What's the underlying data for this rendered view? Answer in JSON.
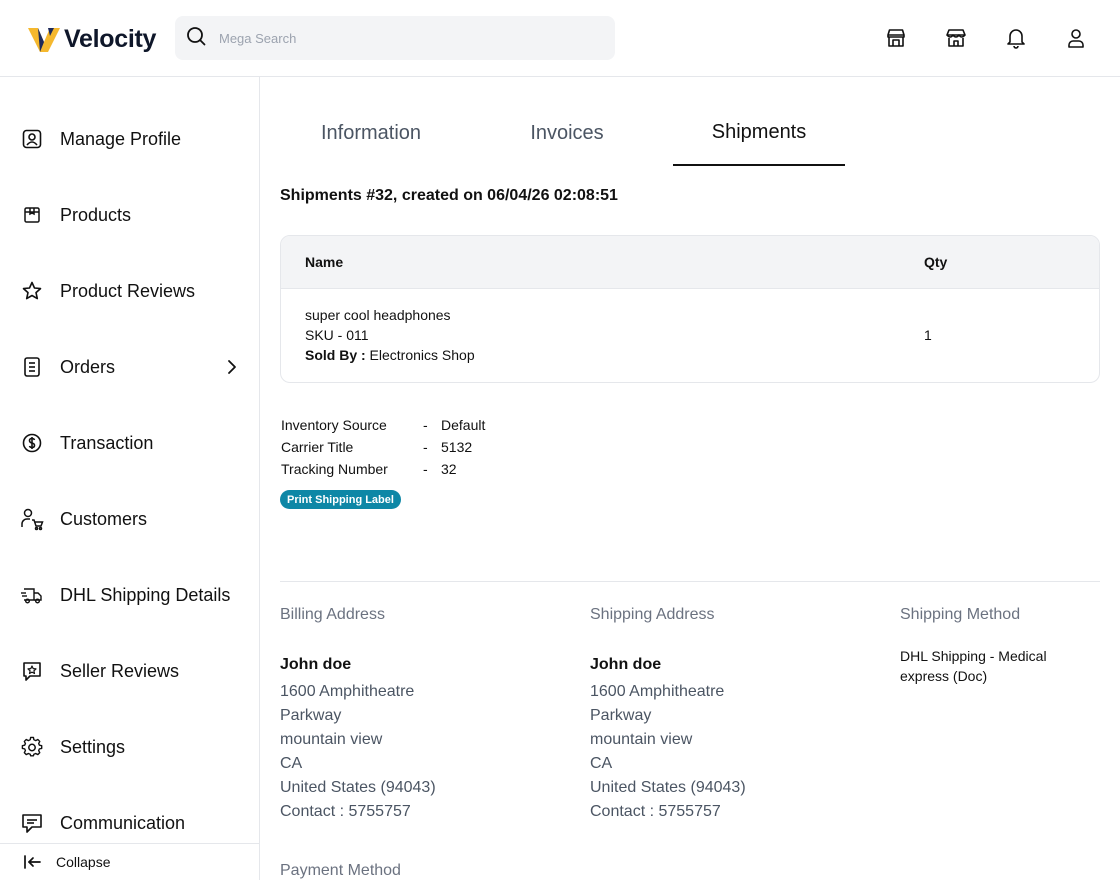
{
  "brand": {
    "name": "Velocity",
    "accent": "#f5b82e"
  },
  "search": {
    "placeholder": "Mega Search",
    "icon": "search-icon"
  },
  "header_icons": [
    "store-icon",
    "shop-icon",
    "bell-icon",
    "user-icon"
  ],
  "sidebar": {
    "items": [
      {
        "label": "Manage Profile",
        "icon": "profile-icon"
      },
      {
        "label": "Products",
        "icon": "box-icon"
      },
      {
        "label": "Product Reviews",
        "icon": "star-icon"
      },
      {
        "label": "Orders",
        "icon": "document-icon",
        "has_chevron": true
      },
      {
        "label": "Transaction",
        "icon": "dollar-icon"
      },
      {
        "label": "Customers",
        "icon": "customer-cart-icon"
      },
      {
        "label": "DHL Shipping Details",
        "icon": "truck-icon"
      },
      {
        "label": "Seller Reviews",
        "icon": "review-icon"
      },
      {
        "label": "Settings",
        "icon": "gear-icon"
      },
      {
        "label": "Communication",
        "icon": "chat-icon"
      }
    ],
    "collapse_label": "Collapse"
  },
  "tabs": [
    {
      "label": "Information",
      "active": false
    },
    {
      "label": "Invoices",
      "active": false
    },
    {
      "label": "Shipments",
      "active": true
    }
  ],
  "shipment": {
    "title": "Shipments #32, created on 06/04/26 02:08:51",
    "table": {
      "headers": {
        "name": "Name",
        "qty": "Qty"
      },
      "rows": [
        {
          "name": "super cool headphones",
          "sku": "SKU - 011",
          "sold_by_label": "Sold By :",
          "sold_by_value": " Electronics Shop",
          "qty": "1"
        }
      ]
    },
    "info": [
      {
        "label": "Inventory Source",
        "dash": "-",
        "value": "Default"
      },
      {
        "label": "Carrier Title",
        "dash": "-",
        "value": "5132"
      },
      {
        "label": "Tracking Number",
        "dash": "-",
        "value": "32"
      }
    ],
    "print_label": "Print Shipping Label",
    "print_color": "#0e87a6"
  },
  "billing": {
    "heading": "Billing Address",
    "name": "John doe",
    "lines": [
      "1600 Amphitheatre",
      "Parkway",
      "mountain view",
      "CA",
      "United States (94043)",
      "Contact : 5755757"
    ]
  },
  "shipping": {
    "heading": "Shipping Address",
    "name": "John doe",
    "lines": [
      "1600 Amphitheatre",
      "Parkway",
      "mountain view",
      "CA",
      "United States (94043)",
      "Contact : 5755757"
    ]
  },
  "method": {
    "heading": "Shipping Method",
    "value": "DHL Shipping - Medical express (Doc)"
  },
  "payment": {
    "heading": "Payment Method"
  }
}
